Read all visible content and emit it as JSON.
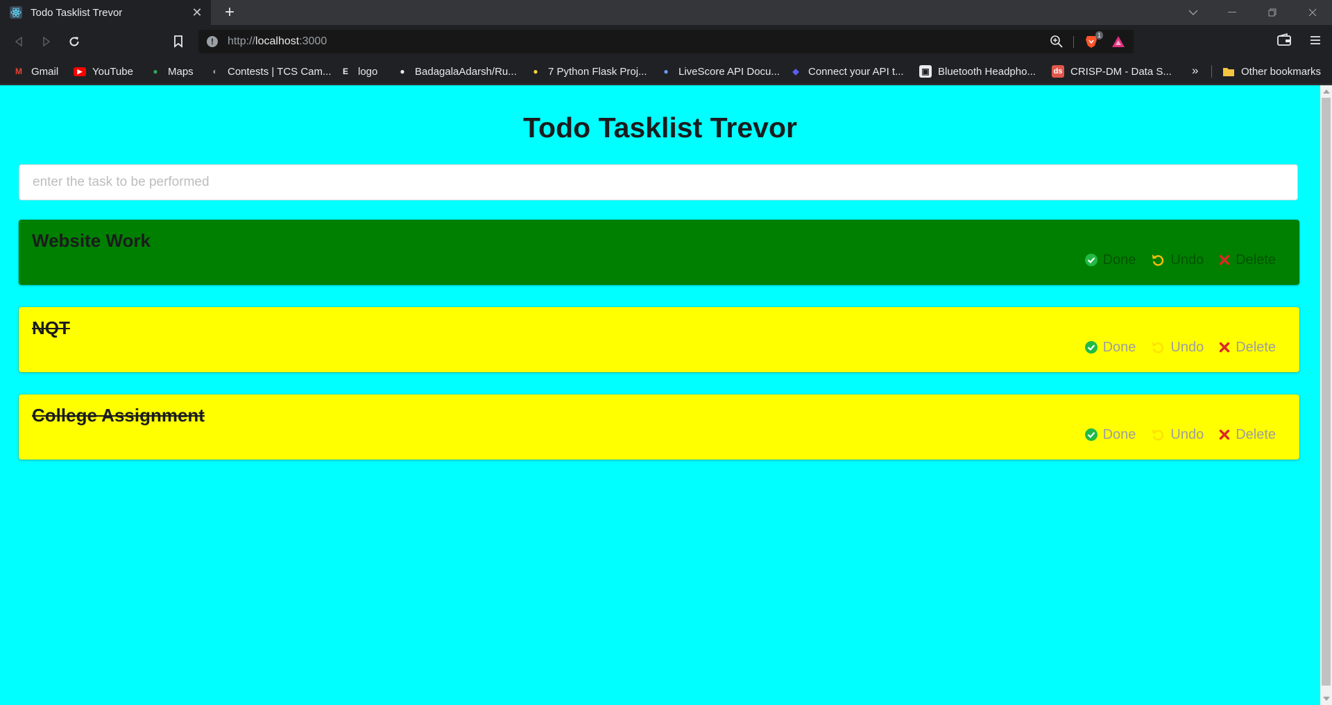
{
  "browser": {
    "tab_title": "Todo Tasklist Trevor",
    "url_scheme": "http://",
    "url_host": "localhost",
    "url_port": ":3000",
    "brave_badge": "1"
  },
  "bookmarks": [
    {
      "label": "Gmail",
      "icon": "gmail-icon",
      "icon_text": "M",
      "icon_color": "#ea4335"
    },
    {
      "label": "YouTube",
      "icon": "youtube-icon",
      "icon_text": "▶",
      "icon_color": "#ff0000"
    },
    {
      "label": "Maps",
      "icon": "maps-icon",
      "icon_text": "●",
      "icon_color": "#34a853"
    },
    {
      "label": "Contests | TCS Cam...",
      "icon": "globe-icon",
      "icon_text": "◐",
      "icon_color": "#9aa0a6"
    },
    {
      "label": "logo",
      "icon": "etsy-icon",
      "icon_text": "E",
      "icon_color": "#e8eaed"
    },
    {
      "label": "BadagalaAdarsh/Ru...",
      "icon": "github-icon",
      "icon_text": "●",
      "icon_color": "#e8eaed"
    },
    {
      "label": "7 Python Flask Proj...",
      "icon": "python-icon",
      "icon_text": "●",
      "icon_color": "#ffd43b"
    },
    {
      "label": "LiveScore API Docu...",
      "icon": "livescore-icon",
      "icon_text": "●",
      "icon_color": "#6f9cf5"
    },
    {
      "label": "Connect your API t...",
      "icon": "api-icon",
      "icon_text": "◆",
      "icon_color": "#5b5ff5"
    },
    {
      "label": "Bluetooth Headpho...",
      "icon": "store-icon",
      "icon_text": "▣",
      "icon_color": "#e8eaed"
    },
    {
      "label": "CRISP-DM - Data S...",
      "icon": "ds-icon",
      "icon_text": "ds",
      "icon_color": "#e2574c"
    }
  ],
  "bookmarks_overflow": "»",
  "other_bookmarks": "Other bookmarks",
  "app": {
    "title": "Todo Tasklist Trevor",
    "input_placeholder": "enter the task to be performed",
    "actions": {
      "done": "Done",
      "undo": "Undo",
      "delete": "Delete"
    }
  },
  "tasks": [
    {
      "title": "Website Work",
      "color": "#008000",
      "completed": false
    },
    {
      "title": "NQT",
      "color": "#ffff00",
      "completed": true
    },
    {
      "title": "College Assignment",
      "color": "#ffff00",
      "completed": true
    }
  ],
  "colors": {
    "page_bg": "#00ffff",
    "done_icon": "#21ba45",
    "undo_icon": "#fbbd08",
    "delete_icon": "#db2828",
    "action_text": "#9e9e9e"
  }
}
